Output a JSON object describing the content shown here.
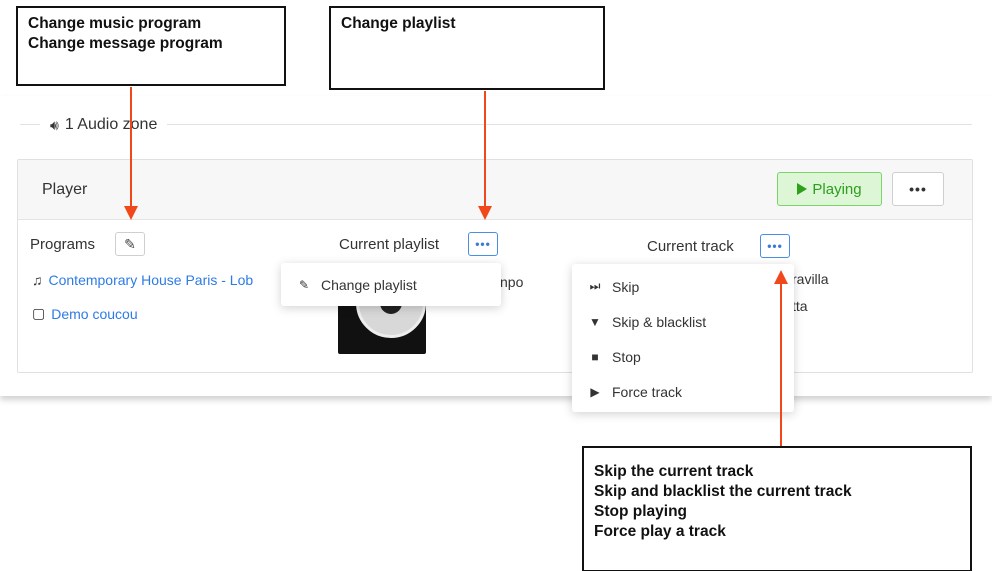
{
  "callouts": {
    "programs": [
      "Change music program",
      "Change message program"
    ],
    "playlist": [
      "Change playlist"
    ],
    "track": [
      "Skip the current track",
      "Skip and blacklist the current track",
      "Stop playing",
      "Force play a track"
    ]
  },
  "zone": {
    "title": "1 Audio zone"
  },
  "player": {
    "title": "Player",
    "playing_label": "Playing",
    "more_label": "•••"
  },
  "programs": {
    "label": "Programs",
    "music_program": "Contemporary House Paris - Lob",
    "message_program": "Demo coucou"
  },
  "current_playlist": {
    "label": "Current playlist",
    "partial_text": "npo"
  },
  "current_track": {
    "label": "Current track",
    "partial_line1": "ravilla",
    "partial_line2": "tta"
  },
  "playlist_menu": {
    "items": [
      "Change playlist"
    ]
  },
  "track_menu": {
    "items": [
      "Skip",
      "Skip & blacklist",
      "Stop",
      "Force track"
    ]
  },
  "colors": {
    "accent": "#2d7be5",
    "playing_green": "#2ea01c",
    "arrow": "#f0481a"
  }
}
